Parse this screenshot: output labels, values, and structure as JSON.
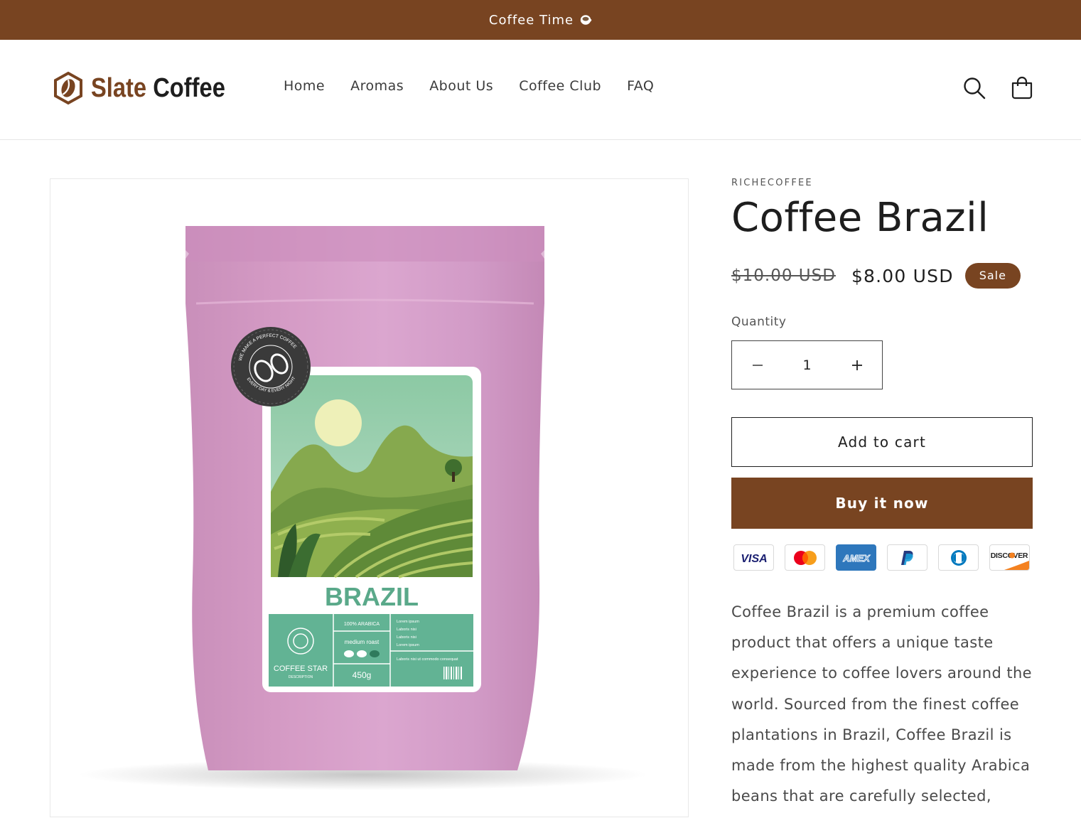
{
  "announcement": {
    "text": "Coffee Time",
    "icon": "coffee-cup-icon"
  },
  "header": {
    "logo": {
      "word1": "Slate",
      "word2": "Coffee",
      "icon": "coffee-bean-hexagon-icon"
    },
    "nav": [
      "Home",
      "Aromas",
      "About Us",
      "Coffee Club",
      "FAQ"
    ],
    "icons": [
      "search-icon",
      "cart-icon"
    ]
  },
  "colors": {
    "brand": "#784421",
    "text": "#1e1e1e",
    "muted": "#555555"
  },
  "product": {
    "vendor": "RICHECOFFEE",
    "title": "Coffee Brazil",
    "price_compare": "$10.00 USD",
    "price_sale": "$8.00 USD",
    "badge": "Sale",
    "quantity_label": "Quantity",
    "quantity": "1",
    "add_to_cart": "Add to cart",
    "buy_now": "Buy it now",
    "payment_methods": [
      "VISA",
      "Mastercard",
      "AMEX",
      "PayPal",
      "Diners Club",
      "DISCOVER"
    ],
    "description": "Coffee Brazil is a premium coffee product that offers a unique taste experience to coffee lovers around the world. Sourced from the finest coffee plantations in Brazil, Coffee Brazil is made from the highest quality Arabica beans that are carefully selected,"
  },
  "image": {
    "label_title": "BRAZIL",
    "label_arabica": "100% ARABICA",
    "label_roast": "medium roast",
    "label_weight": "450g",
    "label_brand": "COFFEE STAR",
    "label_brand_sub": "DESCRIPTION",
    "seal_top": "WE MAKE A PERFECT COFFEE",
    "seal_bottom": "EVERY DAY & EVERY NIGHT",
    "lorem": [
      "Lorem ipsum",
      "Laboris nisi",
      "Laboris nisi",
      "Lorem ipsum"
    ],
    "lorem_footer": "Laboris nisi ut commodo consequat"
  }
}
